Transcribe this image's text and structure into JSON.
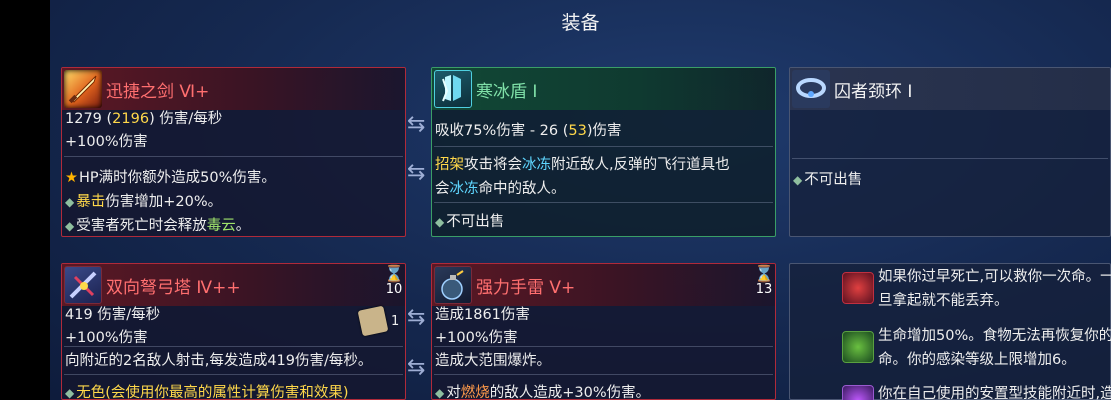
{
  "screen_title": "装备",
  "items": [
    {
      "name": "迅捷之剑 Ⅵ+",
      "line1_a": "1279 (",
      "line1_b": "2196",
      "line1_c": ") 伤害/每秒",
      "line2": "+100%伤害",
      "b1": "HP满时你额外造成50%伤害。",
      "b2_a": "暴击",
      "b2_b": "伤害增加+20%。",
      "b3_a": "受害者死亡时会释放",
      "b3_b": "毒云",
      "b3_c": "。"
    },
    {
      "name": "寒冰盾 Ⅰ",
      "line1_a": "吸收75%伤害 - 26 (",
      "line1_b": "53",
      "line1_c": ")伤害",
      "l2_a": "招架",
      "l2_b": "攻击将会",
      "l2_c": "冰冻",
      "l2_d": "附近敌人,反弹的飞行道具也",
      "l3_a": "会",
      "l3_b": "冰冻",
      "l3_c": "命中的敌人。",
      "note": "不可出售"
    },
    {
      "name": "囚者颈环 Ⅰ",
      "note": "不可出售"
    },
    {
      "name": "双向弩弓塔 Ⅳ++",
      "timer": "10",
      "scroll_count": "1",
      "line1": "419 伤害/每秒",
      "line2": "+100%伤害",
      "line3": "向附近的2名敌人射击,每发造成419伤害/每秒。",
      "b1_a": "无色",
      "b1_b": "(会使用你最高的属性计算伤害和效果)"
    },
    {
      "name": "强力手雷 Ⅴ+",
      "timer": "13",
      "line1": "造成1861伤害",
      "line2": "+100%伤害",
      "line3": "造成大范围爆炸。",
      "b1_a": "对",
      "b1_b": "燃烧",
      "b1_c": "的敌人造成+30%伤害。"
    }
  ],
  "mutations": [
    {
      "line1": "如果你过早死亡,可以救你一次命。一",
      "line2": "旦拿起就不能丢弃。"
    },
    {
      "line1": "生命增加50%。食物无法再恢复你的生",
      "line2": "命。你的感染等级上限增加6。"
    },
    {
      "line1": "你在自己使用的安置型技能附近时,造"
    }
  ],
  "colors": {
    "red_border": "#b02a3a",
    "green_border": "#3a9e67",
    "gold": "#ffd84a",
    "cyan": "#5fd6ff"
  }
}
